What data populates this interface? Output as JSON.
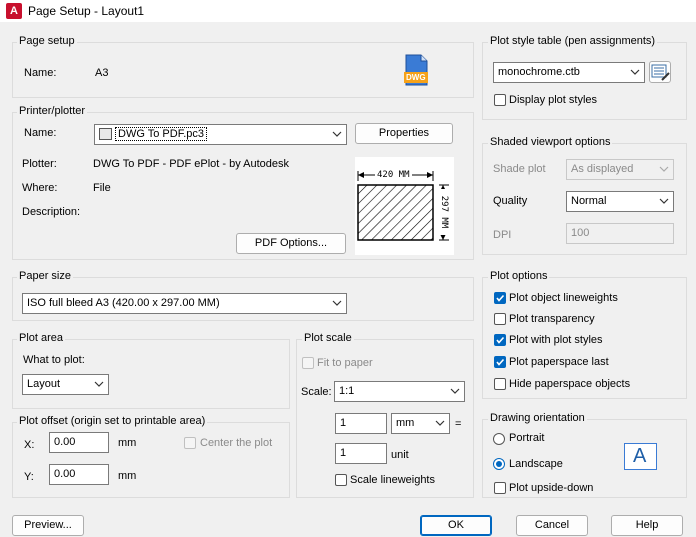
{
  "window": {
    "title": "Page Setup - Layout1",
    "app_icon_letter": "A"
  },
  "page_setup": {
    "group_label": "Page setup",
    "name_label": "Name:",
    "name_value": "A3",
    "dwg_badge": "DWG"
  },
  "printer": {
    "group_label": "Printer/plotter",
    "name_label": "Name:",
    "name_value": "DWG To PDF.pc3",
    "properties_button": "Properties",
    "plotter_label": "Plotter:",
    "plotter_value": "DWG To PDF - PDF ePlot - by Autodesk",
    "where_label": "Where:",
    "where_value": "File",
    "description_label": "Description:",
    "pdf_options_button": "PDF Options...",
    "preview_width": "420 MM",
    "preview_height": "297 MM"
  },
  "paper_size": {
    "group_label": "Paper size",
    "value": "ISO full bleed A3 (420.00 x 297.00 MM)"
  },
  "plot_area": {
    "group_label": "Plot area",
    "what_label": "What to plot:",
    "what_value": "Layout"
  },
  "plot_offset": {
    "group_label": "Plot offset (origin set to printable area)",
    "x_label": "X:",
    "x_value": "0.00",
    "x_unit": "mm",
    "y_label": "Y:",
    "y_value": "0.00",
    "y_unit": "mm",
    "center_label": "Center the plot"
  },
  "plot_scale": {
    "group_label": "Plot scale",
    "fit_label": "Fit to paper",
    "scale_label": "Scale:",
    "scale_value": "1:1",
    "value1": "1",
    "unit_value": "mm",
    "equals": "=",
    "value2": "1",
    "unit_label": "unit",
    "scale_lineweights_label": "Scale lineweights"
  },
  "plot_style": {
    "group_label": "Plot style table (pen assignments)",
    "value": "monochrome.ctb",
    "display_label": "Display plot styles"
  },
  "shaded": {
    "group_label": "Shaded viewport options",
    "shade_label": "Shade plot",
    "shade_value": "As displayed",
    "quality_label": "Quality",
    "quality_value": "Normal",
    "dpi_label": "DPI",
    "dpi_value": "100"
  },
  "plot_options": {
    "group_label": "Plot options",
    "items": [
      {
        "label": "Plot object lineweights",
        "checked": true
      },
      {
        "label": "Plot transparency",
        "checked": false
      },
      {
        "label": "Plot with plot styles",
        "checked": true
      },
      {
        "label": "Plot paperspace last",
        "checked": true
      },
      {
        "label": "Hide paperspace objects",
        "checked": false
      }
    ]
  },
  "orientation": {
    "group_label": "Drawing orientation",
    "portrait": "Portrait",
    "landscape": "Landscape",
    "upside_down": "Plot upside-down",
    "icon_letter": "A"
  },
  "footer": {
    "preview": "Preview...",
    "ok": "OK",
    "cancel": "Cancel",
    "help": "Help"
  }
}
